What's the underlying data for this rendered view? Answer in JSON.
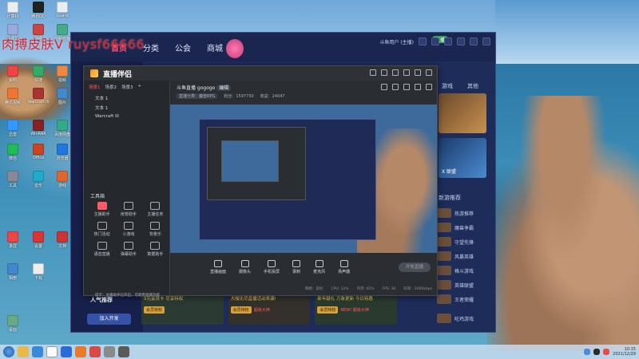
{
  "desktop": {
    "overlay_text": "肉搏皮肤V  ruysf66666",
    "icons": [
      {
        "label": "计算机"
      },
      {
        "label": "腾讯QQ"
      },
      {
        "label": "Guard"
      },
      {
        "label": "回收站"
      },
      {
        "label": "网络"
      },
      {
        "label": "控制面板"
      },
      {
        "label": "资料"
      },
      {
        "label": "快捷"
      },
      {
        "label": "视频"
      },
      {
        "label": "腾讯视频"
      },
      {
        "label": "Warcraft III"
      },
      {
        "label": "图片"
      },
      {
        "label": "迅雷"
      },
      {
        "label": "WinRAR"
      },
      {
        "label": "百度网盘"
      },
      {
        "label": "微信"
      },
      {
        "label": "Office"
      },
      {
        "label": "浏览器"
      },
      {
        "label": "工具"
      },
      {
        "label": "音乐"
      },
      {
        "label": "游戏"
      },
      {
        "label": "录屏"
      },
      {
        "label": "设置"
      },
      {
        "label": "文档"
      },
      {
        "label": "相册"
      },
      {
        "label": "下载"
      },
      {
        "label": "桌面"
      }
    ]
  },
  "app": {
    "nav": [
      "首页",
      "分类",
      "公会",
      "商城"
    ],
    "user_text": "斗鱼用户 (主播)",
    "live_badge": "直播",
    "left_section_title": "人气推荐",
    "left_button": "加入开发",
    "right_tabs": [
      "游戏",
      "其他"
    ],
    "side_header": "新游推荐",
    "side_items": [
      "热游推荐",
      "魔兽争霸",
      "守望先锋",
      "风暴英雄",
      "格斗游戏",
      "英雄联盟",
      "王者荣耀",
      "吃鸡游戏"
    ],
    "thumb_caption": "X 联盟",
    "cards": [
      {
        "title": "5元会员卡 尽享特权",
        "badge": "会员特权",
        "hot": ""
      },
      {
        "title": "大咖无尽直播活动来袭!",
        "badge": "会员特权",
        "hot": "超级大神"
      },
      {
        "title": "新年献礼 万象更新 今日特惠",
        "badge": "会员特权",
        "hot": "NEW! 超级大神"
      }
    ]
  },
  "obs": {
    "title": "直播伴侣",
    "scene_tabs": [
      "场景1",
      "场景2",
      "场景3"
    ],
    "sources": [
      "文本 1",
      "文本 1",
      "Warcraft III"
    ],
    "tools_header": "工具箱",
    "tools": [
      {
        "label": "主播助手",
        "highlight": true
      },
      {
        "label": "房管助手",
        "highlight": false
      },
      {
        "label": "主播任务",
        "highlight": false
      },
      {
        "label": "热门活动",
        "highlight": false
      },
      {
        "label": "小游戏",
        "highlight": false
      },
      {
        "label": "背景乐",
        "highlight": false
      },
      {
        "label": "语音直播",
        "highlight": false
      },
      {
        "label": "弹幕助手",
        "highlight": false
      },
      {
        "label": "数据助手",
        "highlight": false
      }
    ],
    "note": "提示：主播助手已开启，可使用直播功能",
    "room_title": "斗鱼直播 gogogo",
    "room_btn": "编辑",
    "meta": [
      "直播分类：魔兽RPG",
      "粉丝：1597730",
      "收益：24047"
    ],
    "toolbar": [
      "直播画面",
      "摄像头",
      "手机投屏",
      "录制",
      "麦克风",
      "扬声器"
    ],
    "start_label": "开始直播",
    "status": [
      "网络：良好",
      "CPU: 12%",
      "内存: 45%",
      "FPS: 30",
      "码率：2000kbps"
    ]
  },
  "taskbar": {
    "time": "10:15",
    "date": "2021/12/29"
  }
}
